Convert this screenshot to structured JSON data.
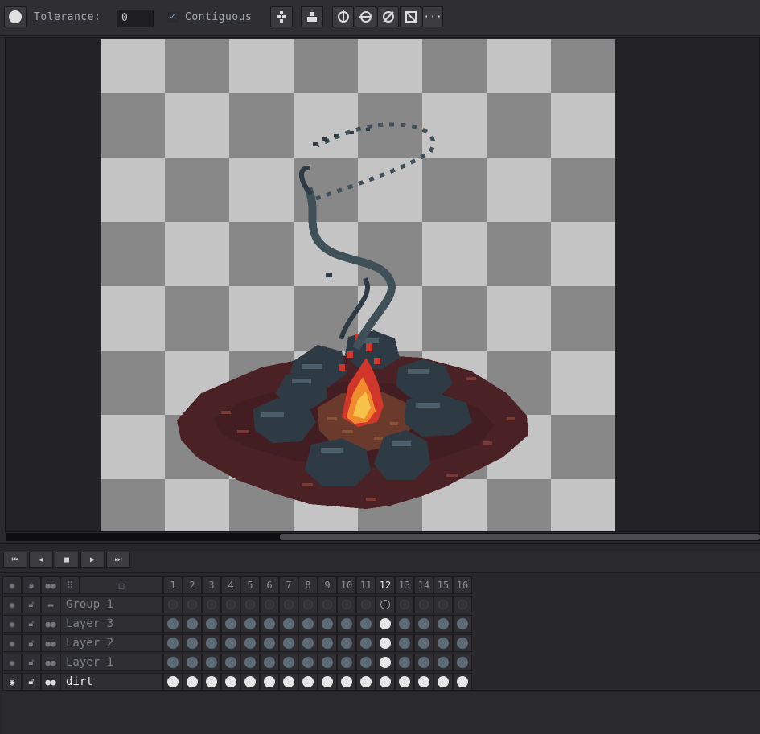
{
  "toolbar": {
    "tolerance_label": "Tolerance:",
    "tolerance_value": "0",
    "contiguous_label": "Contiguous",
    "contiguous_checked": "✓",
    "more_label": "···"
  },
  "playback": {
    "first": "⏮",
    "prev": "◀",
    "stop": "■",
    "next": "▶",
    "last": "⏭"
  },
  "timeline": {
    "frames": [
      "1",
      "2",
      "3",
      "4",
      "5",
      "6",
      "7",
      "8",
      "9",
      "10",
      "11",
      "12",
      "13",
      "14",
      "15",
      "16"
    ],
    "current_frame": "12",
    "layers": [
      {
        "name": "Group 1",
        "type": "group"
      },
      {
        "name": "Layer 3",
        "type": "layer"
      },
      {
        "name": "Layer 2",
        "type": "layer"
      },
      {
        "name": "Layer 1",
        "type": "layer"
      },
      {
        "name": "dirt",
        "type": "layer",
        "active": true
      }
    ]
  },
  "colors": {
    "accent": "#7fa8e0",
    "fire_orange": "#f08a2c",
    "fire_red": "#d0362a",
    "stone": "#2e3a44",
    "smoke": "#3f5058",
    "dirt": "#4a2226"
  }
}
